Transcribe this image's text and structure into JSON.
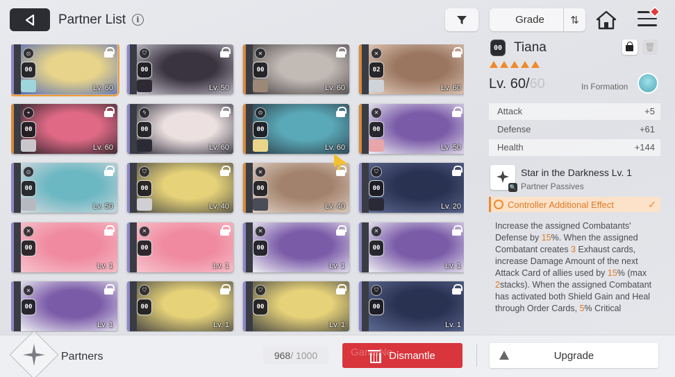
{
  "header": {
    "title": "Partner List",
    "info_glyph": "i",
    "grade_label": "Grade",
    "sort_glyph": "⇅"
  },
  "cards": [
    {
      "badge": "00",
      "level": "Lv. 60",
      "role": "support",
      "stripe": "#8e86c9",
      "bg": [
        "#e8d48a",
        "#5a6fb4"
      ],
      "chip": "#9fd6dc",
      "selected": true
    },
    {
      "badge": "00",
      "level": "Lv. 50",
      "role": "defender",
      "stripe": "#8e86c9",
      "bg": [
        "#3a3340",
        "#c9c6d0"
      ],
      "chip": "#2e2a34",
      "selected": false
    },
    {
      "badge": "00",
      "level": "Lv. 60",
      "role": "attacker",
      "stripe": "#d9893a",
      "bg": [
        "#c2bab4",
        "#4b4548"
      ],
      "chip": "#9d8878",
      "selected": false
    },
    {
      "badge": "02",
      "level": "Lv. 60",
      "role": "attacker",
      "stripe": "#d9893a",
      "bg": [
        "#9a7660",
        "#e5cfbf"
      ],
      "chip": "#cfd4da",
      "selected": false
    },
    {
      "badge": "00",
      "level": "Lv. 60",
      "role": "controller",
      "stripe": "#d9893a",
      "bg": [
        "#e06a86",
        "#2a2228"
      ],
      "chip": "#c9c6cc",
      "selected": false
    },
    {
      "badge": "00",
      "level": "Lv. 60",
      "role": "striker",
      "stripe": "#8e86c9",
      "bg": [
        "#ece0e0",
        "#2d2c3a"
      ],
      "chip": "#2b2b36",
      "selected": false
    },
    {
      "badge": "00",
      "level": "Lv. 60",
      "role": "support",
      "stripe": "#d9893a",
      "bg": [
        "#5aa9b8",
        "#2c3a46"
      ],
      "chip": "#ead68a",
      "selected": false
    },
    {
      "badge": "00",
      "level": "Lv. 50",
      "role": "attacker",
      "stripe": "#d9893a",
      "bg": [
        "#7a5ba8",
        "#f0f0f4"
      ],
      "chip": "#e7a6a9",
      "selected": false
    },
    {
      "badge": "00",
      "level": "Lv. 50",
      "role": "support",
      "stripe": "#8e86c9",
      "bg": [
        "#6bb7c2",
        "#d6dadf"
      ],
      "chip": "#b7b8c1",
      "selected": false
    },
    {
      "badge": "00",
      "level": "Lv. 40",
      "role": "defender",
      "stripe": "#8e86c9",
      "bg": [
        "#e6d279",
        "#4d4c46"
      ],
      "chip": "#d0d0d4",
      "selected": false
    },
    {
      "badge": "00",
      "level": "Lv. 40",
      "role": "attacker",
      "stripe": "#d9893a",
      "bg": [
        "#a2826c",
        "#e2d2c6"
      ],
      "chip": "#4a4c58",
      "selected": false
    },
    {
      "badge": "00",
      "level": "Lv. 20",
      "role": "defender",
      "stripe": "#8e86c9",
      "bg": [
        "#2a3252",
        "#5e6a92"
      ],
      "chip": "#2a2a36",
      "selected": false
    },
    {
      "badge": "00",
      "level": "Lv. 1",
      "role": "attacker",
      "stripe": "#8e86c9",
      "bg": [
        "#f08aa0",
        "#f6c4cc"
      ],
      "chip": "",
      "selected": false
    },
    {
      "badge": "00",
      "level": "Lv. 1",
      "role": "attacker",
      "stripe": "#8e86c9",
      "bg": [
        "#f08aa0",
        "#f6c4cc"
      ],
      "chip": "",
      "selected": false
    },
    {
      "badge": "00",
      "level": "Lv. 1",
      "role": "attacker",
      "stripe": "#8e86c9",
      "bg": [
        "#7a5ba8",
        "#f0f0f4"
      ],
      "chip": "",
      "selected": false
    },
    {
      "badge": "00",
      "level": "Lv. 1",
      "role": "attacker",
      "stripe": "#8e86c9",
      "bg": [
        "#7a5ba8",
        "#f0f0f4"
      ],
      "chip": "",
      "selected": false
    },
    {
      "badge": "00",
      "level": "Lv. 1",
      "role": "attacker",
      "stripe": "#8e86c9",
      "bg": [
        "#7a5ba8",
        "#f0f0f4"
      ],
      "chip": "",
      "selected": false
    },
    {
      "badge": "00",
      "level": "Lv. 1",
      "role": "defender",
      "stripe": "#8e86c9",
      "bg": [
        "#e6d279",
        "#4d4c46"
      ],
      "chip": "",
      "selected": false
    },
    {
      "badge": "00",
      "level": "Lv. 1",
      "role": "defender",
      "stripe": "#8e86c9",
      "bg": [
        "#e6d279",
        "#4d4c46"
      ],
      "chip": "",
      "selected": false
    },
    {
      "badge": "00",
      "level": "Lv. 1",
      "role": "defender",
      "stripe": "#8e86c9",
      "bg": [
        "#2a3252",
        "#5e6a92"
      ],
      "chip": "",
      "selected": false
    }
  ],
  "detail": {
    "badge": "00",
    "name": "Tiana",
    "stars": 5,
    "level": "Lv. 60/",
    "max_level": "60",
    "in_formation": "In Formation",
    "stats": [
      {
        "label": "Attack",
        "value": "+5"
      },
      {
        "label": "Defense",
        "value": "+61"
      },
      {
        "label": "Health",
        "value": "+144"
      }
    ],
    "skill_name": "Star in the Darkness Lv. 1",
    "skill_sub": "Partner Passives",
    "controller_effect": "Controller Additional Effect",
    "check_glyph": "✓",
    "desc": [
      {
        "t": "Increase the assigned Combatants' Defense by "
      },
      {
        "t": "15",
        "hl": true
      },
      {
        "t": "%. When the assigned Combatant creates "
      },
      {
        "t": "3",
        "hl": true
      },
      {
        "t": " Exhaust cards, increase Damage Amount of the next Attack Card of allies used by "
      },
      {
        "t": "15",
        "hl": true
      },
      {
        "t": "% (max "
      },
      {
        "t": "2",
        "hl": true
      },
      {
        "t": "stacks). When the assigned Combatant has activated both Shield Gain and Heal through Order Cards, "
      },
      {
        "t": "5",
        "hl": true
      },
      {
        "t": "% Critical"
      }
    ]
  },
  "footer": {
    "partners_label": "Partners",
    "count": "968",
    "capacity": " / 1000",
    "dismantle": "Dismantle",
    "upgrade": "Upgrade",
    "watermark": "GameNe"
  },
  "colors": {
    "accent": "#ef8a2c",
    "danger": "#d9353c"
  }
}
